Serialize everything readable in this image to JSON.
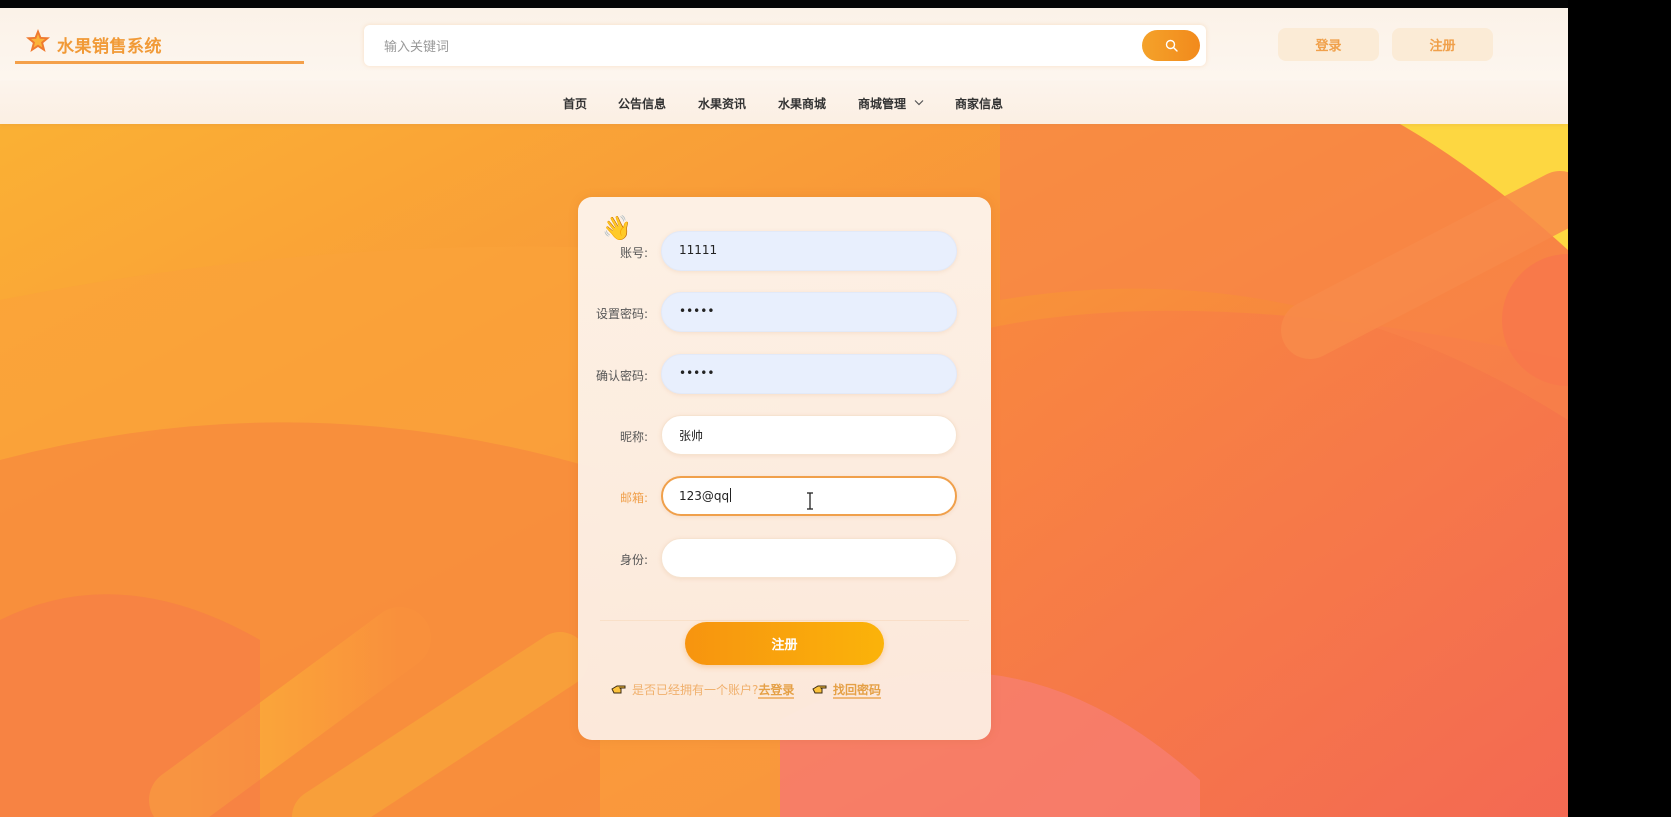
{
  "header": {
    "app_title": "水果销售系统",
    "search_placeholder": "输入关键词",
    "login_label": "登录",
    "register_label": "注册"
  },
  "nav": {
    "items": [
      "首页",
      "公告信息",
      "水果资讯",
      "水果商城",
      "商城管理",
      "商家信息"
    ]
  },
  "form": {
    "fields": [
      {
        "label": "账号:",
        "value": "11111",
        "state": "filled"
      },
      {
        "label": "设置密码:",
        "value": "•••••",
        "state": "filled"
      },
      {
        "label": "确认密码:",
        "value": "•••••",
        "state": "filled"
      },
      {
        "label": "昵称:",
        "value": "张帅",
        "state": "normal"
      },
      {
        "label": "邮箱:",
        "value": "123@qq",
        "state": "focused"
      },
      {
        "label": "身份:",
        "value": "",
        "state": "normal"
      }
    ],
    "submit_label": "注册",
    "have_account_text": "是否已经拥有一个账户?",
    "go_login_label": "去登录",
    "forgot_label": "找回密码"
  },
  "colors": {
    "accent": "#f0a04b",
    "button_gradient_start": "#f7940f",
    "button_gradient_end": "#fbb30a"
  }
}
